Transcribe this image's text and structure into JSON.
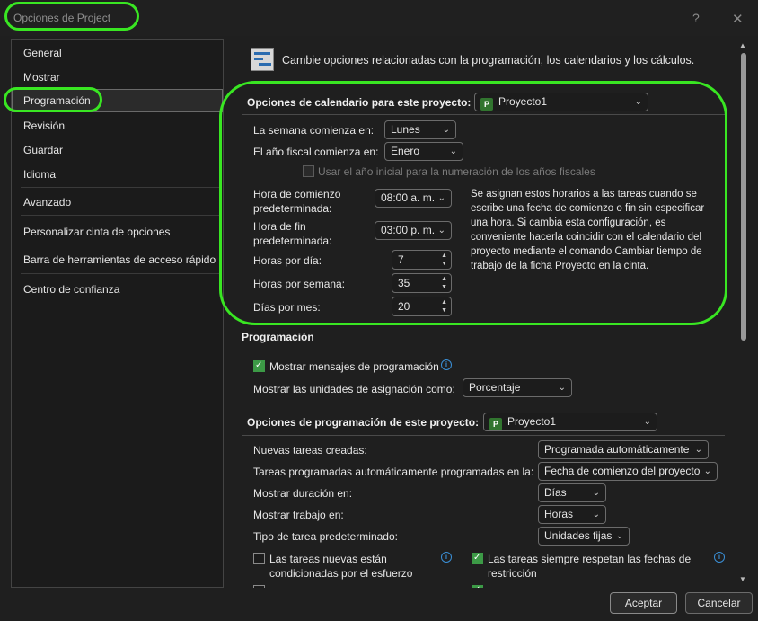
{
  "window": {
    "title": "Opciones de Project",
    "help_glyph": "?",
    "close_glyph": "✕"
  },
  "nav": {
    "items": [
      {
        "label": "General"
      },
      {
        "label": "Mostrar"
      },
      {
        "label": "Programación"
      },
      {
        "label": "Revisión"
      },
      {
        "label": "Guardar"
      },
      {
        "label": "Idioma"
      },
      {
        "label": "Avanzado"
      },
      {
        "label": "Personalizar cinta de opciones"
      },
      {
        "label": "Barra de herramientas de acceso rápido"
      },
      {
        "label": "Centro de confianza"
      }
    ],
    "active_index": 2
  },
  "header": {
    "text": "Cambie opciones relacionadas con la programación, los calendarios y los cálculos."
  },
  "calendar": {
    "title": "Opciones de calendario para este proyecto:",
    "project": "Proyecto1",
    "week_start_label": "La semana comienza en:",
    "week_start_value": "Lunes",
    "fiscal_start_label": "El año fiscal comienza en:",
    "fiscal_start_value": "Enero",
    "use_start_year_label": "Usar el año inicial para la numeración de los años fiscales",
    "default_start_label_1": "Hora de comienzo",
    "default_start_label_2": "predeterminada:",
    "default_start_value": "08:00 a. m.",
    "default_end_label_1": "Hora de fin",
    "default_end_label_2": "predeterminada:",
    "default_end_value": "03:00 p. m.",
    "hours_per_day_label": "Horas por día:",
    "hours_per_day_value": "7",
    "hours_per_week_label": "Horas por semana:",
    "hours_per_week_value": "35",
    "days_per_month_label": "Días por mes:",
    "days_per_month_value": "20",
    "description": "Se asignan estos horarios a las tareas cuando se escribe una fecha de comienzo o fin sin especificar una hora. Si cambia esta configuración, es conveniente hacerla coincidir con el calendario del proyecto mediante el comando Cambiar tiempo de trabajo de la ficha Proyecto en la cinta."
  },
  "scheduling": {
    "title": "Programación",
    "show_messages_label": "Mostrar mensajes de programación",
    "show_units_label": "Mostrar las unidades de asignación como:",
    "show_units_value": "Porcentaje"
  },
  "project_scheduling": {
    "title": "Opciones de programación de este proyecto:",
    "project": "Proyecto1",
    "new_tasks_label": "Nuevas tareas creadas:",
    "new_tasks_value": "Programada automáticamente",
    "auto_tasks_label": "Tareas programadas automáticamente programadas en la:",
    "auto_tasks_value": "Fecha de comienzo del proyecto",
    "duration_label": "Mostrar duración en:",
    "duration_value": "Días",
    "work_label": "Mostrar trabajo en:",
    "work_value": "Horas",
    "task_type_label": "Tipo de tarea predeterminado:",
    "task_type_value": "Unidades fijas",
    "effort_driven_1": "Las tareas nuevas están",
    "effort_driven_2": "condicionadas por el esfuerzo",
    "honor_constraints_1": "Las tareas siempre respetan las fechas de",
    "honor_constraints_2": "restricción"
  },
  "footer": {
    "ok": "Aceptar",
    "cancel": "Cancelar"
  },
  "colors": {
    "annotation": "#39e622",
    "check_accent": "#3c9a46",
    "info": "#3a8fd6",
    "project_icon": "#31752f"
  },
  "icons": {
    "dropdown": "chevron-down-icon",
    "spinner": "spinner-arrows-icon",
    "info": "info-icon",
    "project": "project-file-icon"
  }
}
